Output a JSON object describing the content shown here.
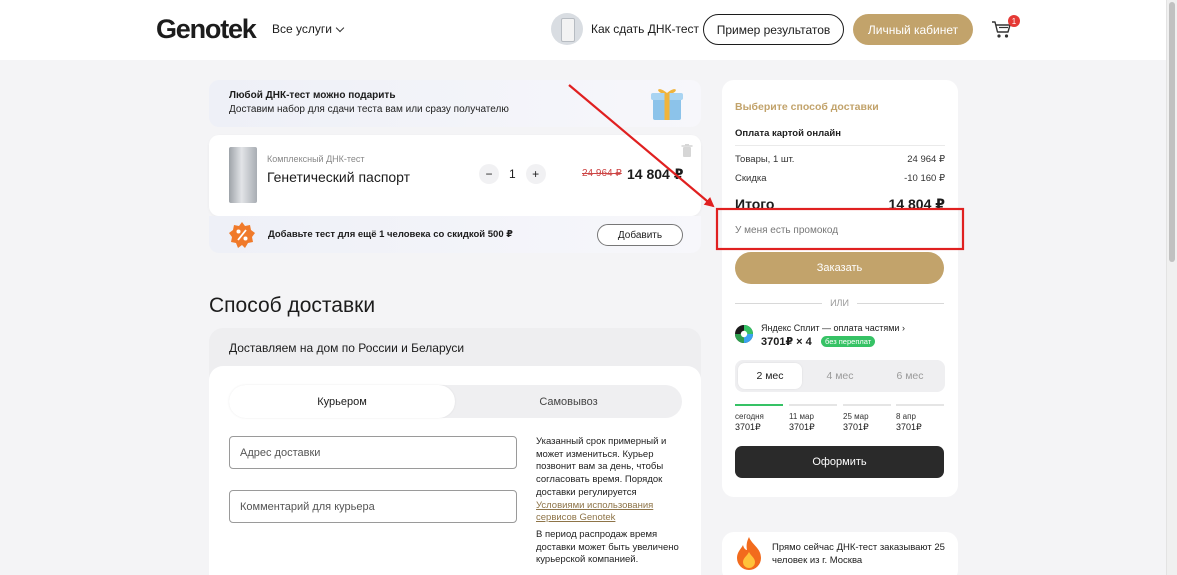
{
  "header": {
    "logo": "Genotek",
    "services_label": "Все услуги",
    "howto_label": "Как сдать ДНК-тест",
    "example_button": "Пример результатов",
    "cabinet_button": "Личный кабинет",
    "cart_count": "1"
  },
  "gift_banner": {
    "title": "Любой ДНК-тест можно подарить",
    "subtitle": "Доставим набор для сдачи теста вам или сразу получателю"
  },
  "product": {
    "label": "Комплексный ДНК-тест",
    "name": "Генетический паспорт",
    "minus": "−",
    "quantity": "1",
    "plus": "+",
    "price_old": "24 964 ₽",
    "price_new": "14 804 ₽"
  },
  "add_banner": {
    "text": "Добавьте тест для ещё 1 человека со скидкой 500 ₽",
    "button": "Добавить"
  },
  "delivery": {
    "heading": "Способ доставки",
    "card_title": "Доставляем на дом по России и Беларуси",
    "tab_courier": "Курьером",
    "tab_pickup": "Самовывоз",
    "address_placeholder": "Адрес доставки",
    "comment_placeholder": "Комментарий для курьера",
    "note_1": "Указанный срок примерный и может измениться. Курьер позвонит вам за день, чтобы согласовать время. Порядок доставки регулируется",
    "note_link": "Условиями использования сервисов Genotek",
    "note_2": "В период распродаж время доставки может быть увеличено курьерской компанией."
  },
  "summary": {
    "title": "Выберите способ доставки",
    "payment": "Оплата картой онлайн",
    "goods_label": "Товары, 1 шт.",
    "goods_value": "24 964 ₽",
    "discount_label": "Скидка",
    "discount_value": "-10 160 ₽",
    "total_label": "Итого",
    "total_value": "14 804 ₽",
    "promo_label": "У меня есть промокод",
    "order_button": "Заказать",
    "or_label": "ИЛИ",
    "split_title": "Яндекс Сплит — оплата частями",
    "split_value": "3701₽ × 4",
    "split_badge": "без переплат",
    "tabs": [
      "2 мес",
      "4 мес",
      "6 мес"
    ],
    "schedule": [
      {
        "date": "сегодня",
        "amount": "3701₽"
      },
      {
        "date": "11 мар",
        "amount": "3701₽"
      },
      {
        "date": "25 мар",
        "amount": "3701₽"
      },
      {
        "date": "8 апр",
        "amount": "3701₽"
      }
    ],
    "checkout_button": "Оформить"
  },
  "proof": {
    "text": "Прямо сейчас ДНК-тест заказывают 25 человек из г. Москва"
  },
  "colors": {
    "accent_gold": "#c2a36b",
    "annotation_red": "#e02020",
    "split_green": "#36c265",
    "dark_button": "#2a2a2a"
  },
  "icons": [
    "chevron-down-icon",
    "cart-icon",
    "gift-icon",
    "trash-icon",
    "percent-badge-icon",
    "yandex-split-icon",
    "fire-icon"
  ]
}
